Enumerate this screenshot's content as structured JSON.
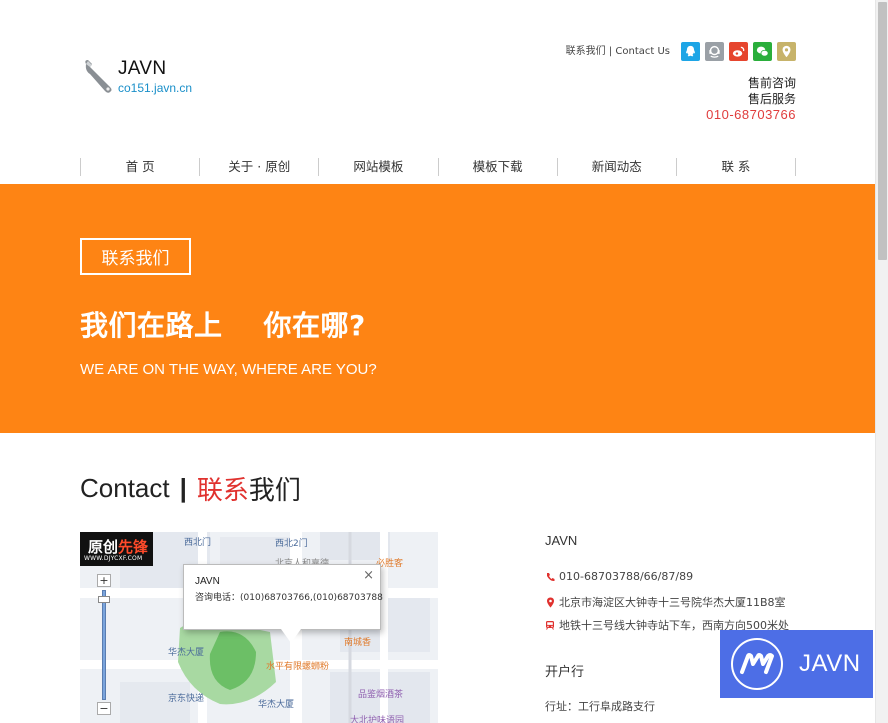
{
  "header": {
    "logo_name": "JAVN",
    "logo_domain": "co151.javn.cn",
    "contact_link": "联系我们 | Contact Us",
    "social_icons": [
      {
        "name": "qq-icon",
        "color": "#1da5e6"
      },
      {
        "name": "support-icon",
        "color": "#9aa0a6"
      },
      {
        "name": "weibo-icon",
        "color": "#e6452e"
      },
      {
        "name": "wechat-icon",
        "color": "#2aae3b"
      },
      {
        "name": "location-icon",
        "color": "#c7b36a"
      }
    ],
    "service_presale": "售前咨询",
    "service_aftersale": "售后服务",
    "service_phone": "010-68703766"
  },
  "nav": [
    "首 页",
    "关于 · 原创",
    "网站模板",
    "模板下载",
    "新闻动态",
    "联 系"
  ],
  "banner": {
    "button_label": "联系我们",
    "title": "我们在路上    你在哪?",
    "subtitle": "WE ARE ON THE WAY, WHERE ARE YOU?",
    "background": "#fe8414"
  },
  "section": {
    "title_en": "Contact",
    "title_sep": "|",
    "title_red": "联系",
    "title_black": "我们"
  },
  "map": {
    "badge_title_white": "原创",
    "badge_title_red": "先锋",
    "badge_url": "WWW.DJYCXF.COM",
    "zoom_in": "+",
    "zoom_out": "−",
    "popup_title": "JAVN",
    "popup_text": "咨询电话：(010)68703766,(010)68703788",
    "popup_close": "×",
    "labels": {
      "xibeimen": "西北门",
      "xibei2men": "西北2门",
      "beijing_renhe": "北京人和嘉德",
      "bishengke": "必胜客",
      "nanchengxiang": "南城香",
      "huajie_dasha": "华杰大厦",
      "shuiping_luosifen": "水平有限螺蛳粉",
      "jingdong_kuaidi": "京东快递",
      "huajie_dasha2": "华杰大厦",
      "pinjian_jiujia": "品鉴烟酒茶",
      "dabei_yuguan": "大北护味语园"
    }
  },
  "info": {
    "company": "JAVN",
    "phone": "010-68703788/66/87/89",
    "address": "北京市海淀区大钟寺十三号院华杰大厦11B8室",
    "transit": "地铁十三号线大钟寺站下车，西南方向500米处",
    "bank_heading": "开户行",
    "bank_address": "行址：工行阜成路支行",
    "icon_color": "#e0312e"
  },
  "float_badge": {
    "text": "JAVN",
    "color": "#4d6ee6"
  }
}
